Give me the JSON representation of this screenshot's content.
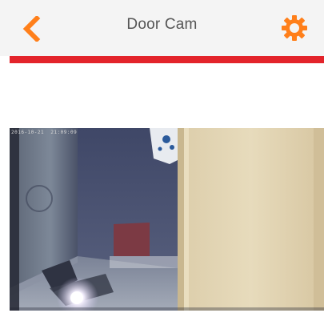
{
  "header": {
    "title": "Door Cam",
    "back_icon": "chevron-left-icon",
    "settings_icon": "gear-icon"
  },
  "colors": {
    "accent": "#ff7f1a",
    "accent_bar": "#e3242b",
    "header_bg": "#f4f4f4"
  },
  "camera": {
    "timestamp": "2016-10-21  21:09:09"
  }
}
